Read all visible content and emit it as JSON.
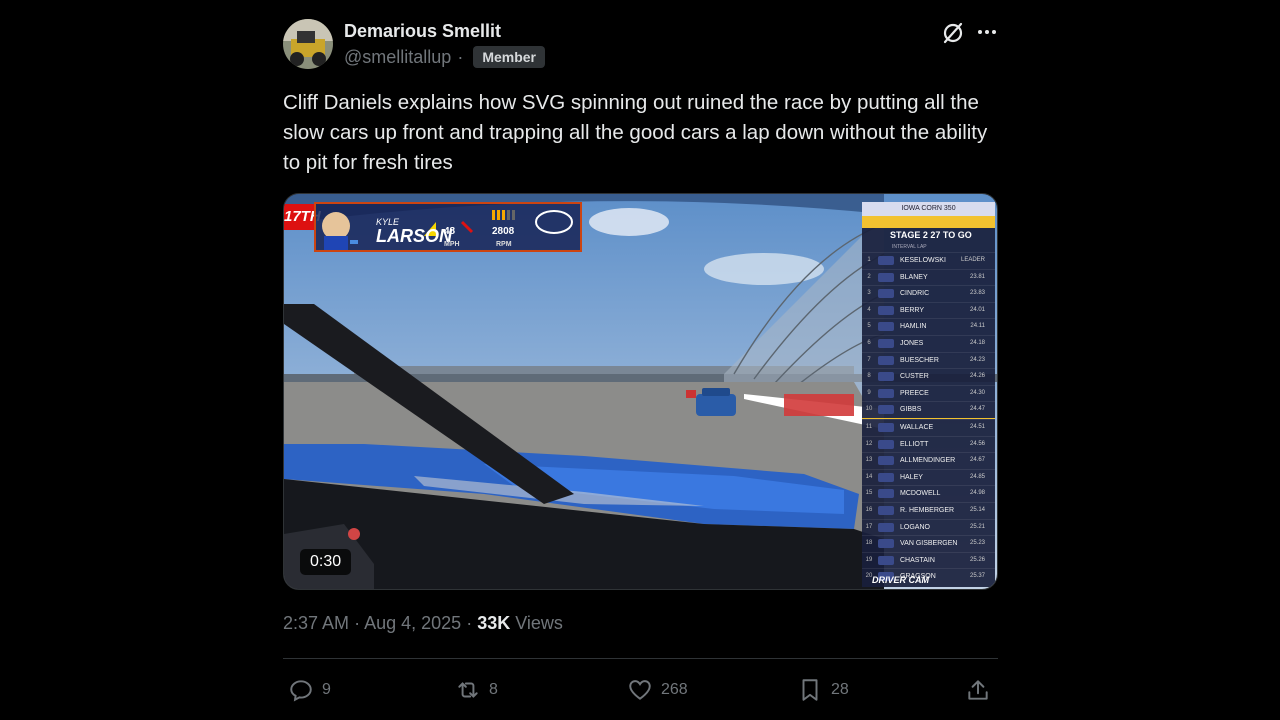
{
  "author": {
    "name": "Demarious Smellit",
    "handle": "@smellitallup",
    "badge": "Member"
  },
  "tweet_text": "Cliff Daniels explains how SVG spinning out ruined the race by putting all the slow cars up front and trapping all the good cars a lap down without the ability to pit for fresh tires",
  "media": {
    "duration": "0:30",
    "hud": {
      "position": "17TH",
      "first_name": "KYLE",
      "last_name": "LARSON",
      "gear": "48",
      "rpm": "2808",
      "mph_label": "MPH",
      "rpm_label": "RPM"
    },
    "leaderboard": {
      "race": "IOWA CORN 350",
      "stage": "STAGE 2  27 TO GO",
      "subheader": "INTERVAL  LAP",
      "drivers": [
        {
          "pos": "1",
          "name": "KESELOWSKI",
          "time": "LEADER"
        },
        {
          "pos": "2",
          "name": "BLANEY",
          "time": "23.81"
        },
        {
          "pos": "3",
          "name": "CINDRIC",
          "time": "23.83"
        },
        {
          "pos": "4",
          "name": "BERRY",
          "time": "24.01"
        },
        {
          "pos": "5",
          "name": "HAMLIN",
          "time": "24.11"
        },
        {
          "pos": "6",
          "name": "JONES",
          "time": "24.18"
        },
        {
          "pos": "7",
          "name": "BUESCHER",
          "time": "24.23"
        },
        {
          "pos": "8",
          "name": "CUSTER",
          "time": "24.26"
        },
        {
          "pos": "9",
          "name": "PREECE",
          "time": "24.30"
        },
        {
          "pos": "10",
          "name": "GIBBS",
          "time": "24.47"
        },
        {
          "pos": "11",
          "name": "WALLACE",
          "time": "24.51"
        },
        {
          "pos": "12",
          "name": "ELLIOTT",
          "time": "24.56"
        },
        {
          "pos": "13",
          "name": "ALLMENDINGER",
          "time": "24.67"
        },
        {
          "pos": "14",
          "name": "HALEY",
          "time": "24.85"
        },
        {
          "pos": "15",
          "name": "MCDOWELL",
          "time": "24.98"
        },
        {
          "pos": "16",
          "name": "R. HEMBERGER",
          "time": "25.14"
        },
        {
          "pos": "17",
          "name": "LOGANO",
          "time": "25.21"
        },
        {
          "pos": "18",
          "name": "VAN GISBERGEN",
          "time": "25.23"
        },
        {
          "pos": "19",
          "name": "CHASTAIN",
          "time": "25.26"
        },
        {
          "pos": "20",
          "name": "GRAGSON",
          "time": "25.37"
        }
      ],
      "footer": "DRIVER CAM"
    }
  },
  "meta": {
    "time": "2:37 AM",
    "date": "Aug 4, 2025",
    "views_count": "33K",
    "views_label": "Views"
  },
  "actions": {
    "replies": "9",
    "reposts": "8",
    "likes": "268",
    "bookmarks": "28"
  },
  "colors": {
    "background": "#000000",
    "text": "#e7e9ea",
    "muted": "#71767b",
    "hud_red": "#dd1111"
  }
}
